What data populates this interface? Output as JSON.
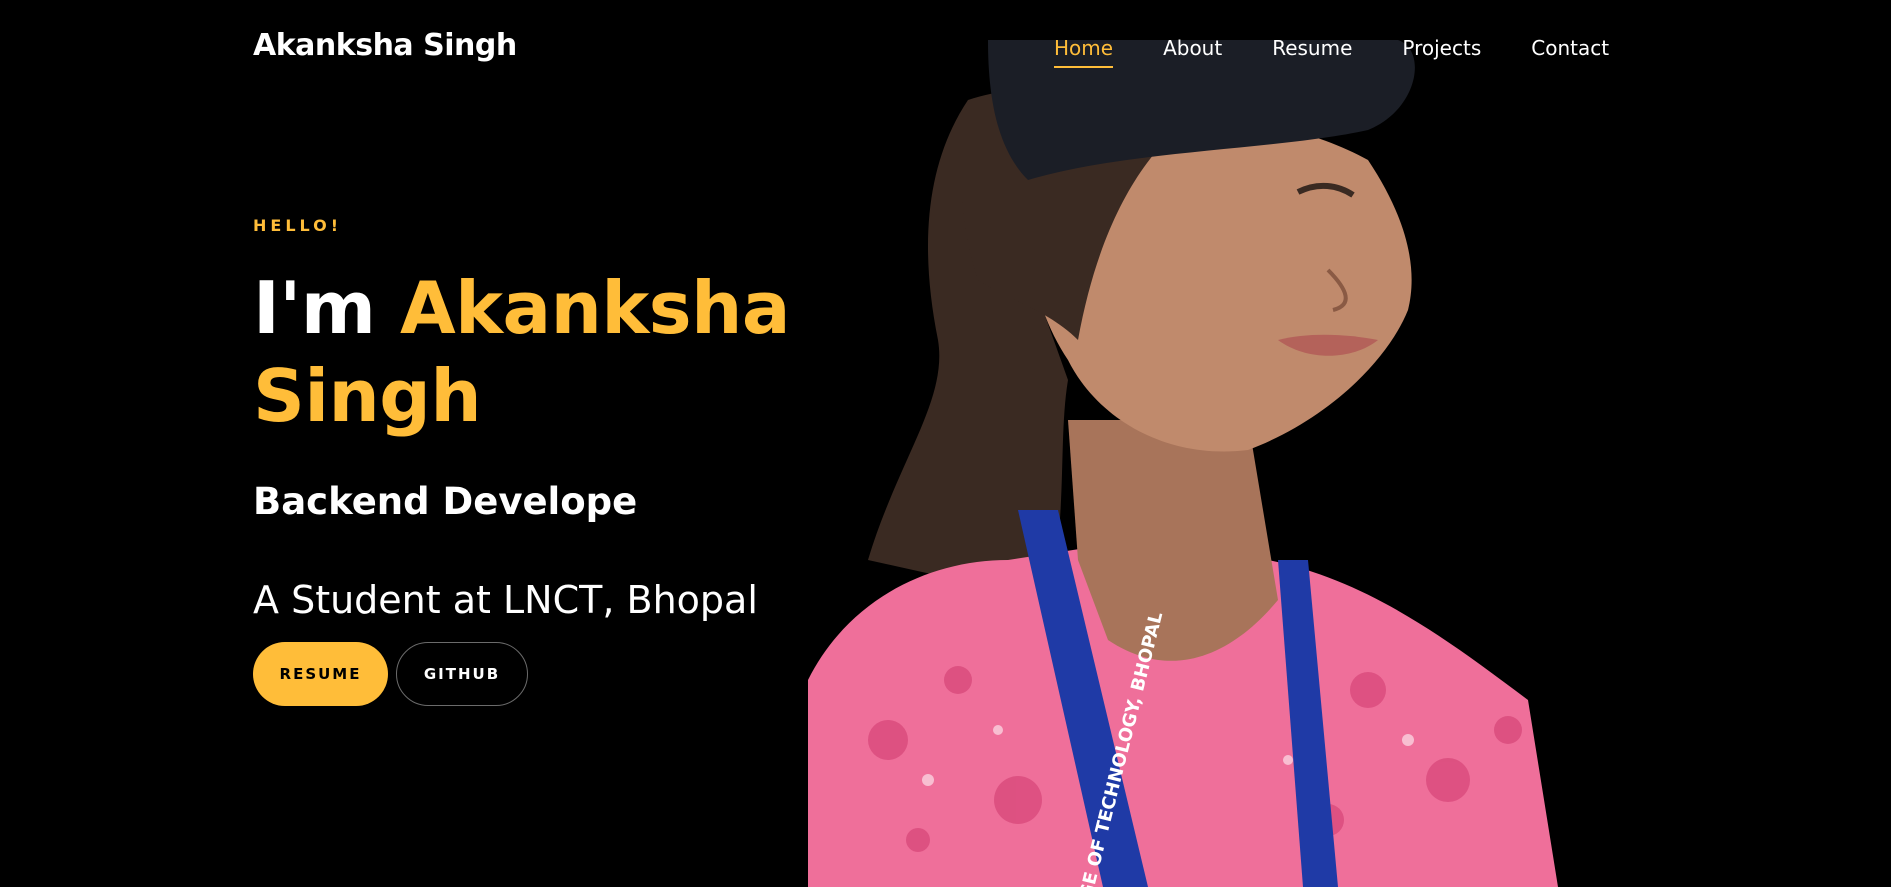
{
  "header": {
    "brand": "Akanksha Singh",
    "nav": [
      {
        "label": "Home",
        "active": true
      },
      {
        "label": "About",
        "active": false
      },
      {
        "label": "Resume",
        "active": false
      },
      {
        "label": "Projects",
        "active": false
      },
      {
        "label": "Contact",
        "active": false
      }
    ]
  },
  "hero": {
    "greeting": "HELLO!",
    "headline_prefix": "I'm",
    "headline_name_first": "Akanksha",
    "headline_name_last": "Singh",
    "role": "Backend Develope",
    "subtitle": "A Student at LNCT, Bhopal",
    "buttons": {
      "resume": "RESUME",
      "github": "GITHUB"
    },
    "portrait": {
      "lanyard_text": "GE OF TECHNOLOGY, BHOPAL"
    }
  },
  "colors": {
    "accent": "#ffbd39",
    "background": "#000000",
    "text": "#ffffff"
  }
}
